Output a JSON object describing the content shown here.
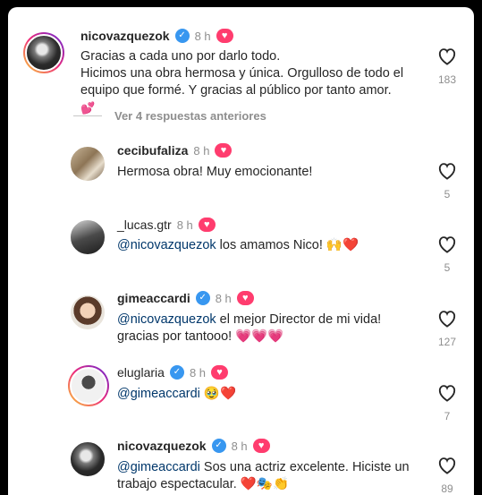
{
  "comments": [
    {
      "username": "nicovazquezok",
      "verified": true,
      "time": "8 h",
      "lines": [
        "Gracias a cada uno por darlo todo.",
        "Hicimos una obra hermosa y única. Orgulloso de todo el",
        "equipo que formé. Y gracias al público por tanto amor."
      ],
      "trail": "💕",
      "likes": "183"
    },
    {
      "username": "cecibufaliza",
      "verified": false,
      "time": "8 h",
      "text": "Hermosa obra! Muy emocionante!",
      "likes": "5"
    },
    {
      "username": "_lucas.gtr",
      "verified": false,
      "time": "8 h",
      "mention": "@nicovazquezok",
      "text": " los amamos Nico! 🙌❤️",
      "likes": "5"
    },
    {
      "username": "gimeaccardi",
      "verified": true,
      "time": "8 h",
      "mention": "@nicovazquezok",
      "text": " el mejor Director de mi vida!",
      "line2": "gracias por tantooo! 💗💗💗",
      "likes": "127"
    },
    {
      "username": "eluglaria",
      "verified": true,
      "time": "8 h",
      "mention": "@gimeaccardi",
      "text": " 🥹❤️",
      "likes": "7"
    },
    {
      "username": "nicovazquezok",
      "verified": true,
      "time": "8 h",
      "mention": "@gimeaccardi",
      "text": " Sos una actriz excelente. Hiciste un",
      "line2": "trabajo espectacular. ❤️🎭👏",
      "likes": "89"
    }
  ],
  "replies_label": "Ver 4 respuestas anteriores",
  "icons": {
    "verified": "verified-badge-icon",
    "heart_badge": "creator-liked-heart-icon",
    "like": "heart-outline-icon"
  },
  "colors": {
    "verified": "#3897f0",
    "heart_badge": "#ff3c6e",
    "mention": "#00376b",
    "meta": "#8e8e8e"
  }
}
